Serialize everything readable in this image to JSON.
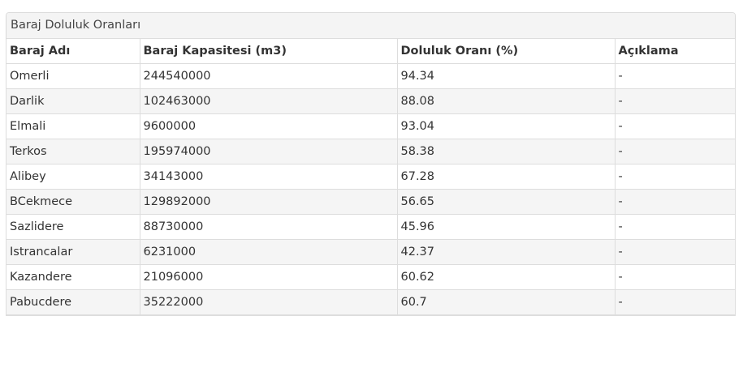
{
  "panel": {
    "title": "Baraj Doluluk Oranları"
  },
  "table": {
    "headers": [
      "Baraj Adı",
      "Baraj Kapasitesi (m3)",
      "Doluluk Oranı (%)",
      "Açıklama"
    ],
    "rows": [
      [
        "Omerli",
        "244540000",
        "94.34",
        "-"
      ],
      [
        "Darlik",
        "102463000",
        "88.08",
        "-"
      ],
      [
        "Elmali",
        "9600000",
        "93.04",
        "-"
      ],
      [
        "Terkos",
        "195974000",
        "58.38",
        "-"
      ],
      [
        "Alibey",
        "34143000",
        "67.28",
        "-"
      ],
      [
        "BCekmece",
        "129892000",
        "56.65",
        "-"
      ],
      [
        "Sazlidere",
        "88730000",
        "45.96",
        "-"
      ],
      [
        "Istrancalar",
        "6231000",
        "42.37",
        "-"
      ],
      [
        "Kazandere",
        "21096000",
        "60.62",
        "-"
      ],
      [
        "Pabucdere",
        "35222000",
        "60.7",
        "-"
      ]
    ]
  }
}
